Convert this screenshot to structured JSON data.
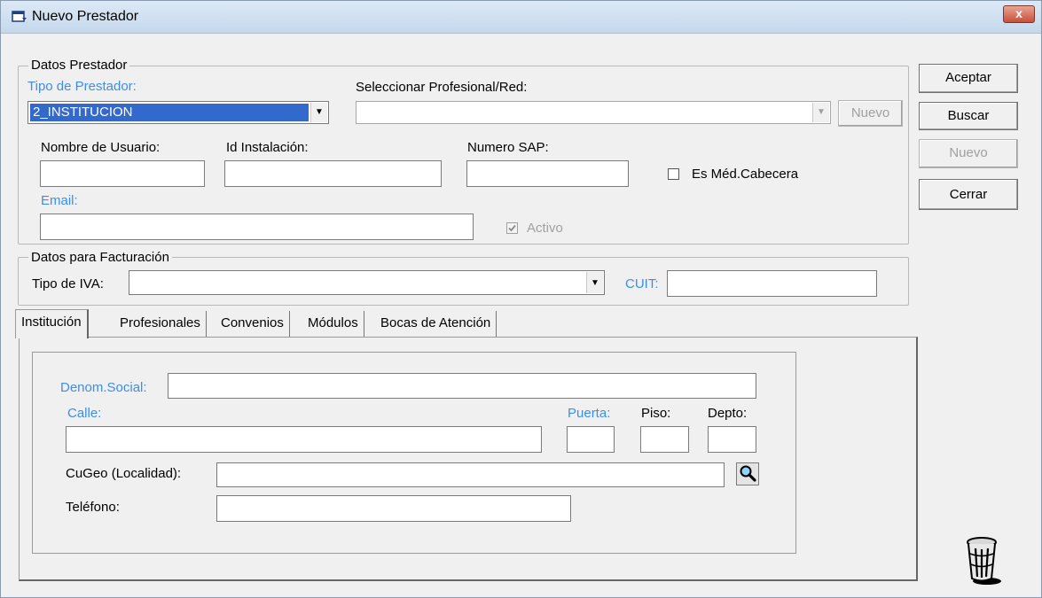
{
  "window": {
    "title": "Nuevo Prestador",
    "close_label": "x"
  },
  "datos_prestador": {
    "legend": "Datos Prestador",
    "tipo_label": "Tipo de Prestador:",
    "tipo_value": "2_INSTITUCION",
    "profesional_label": "Seleccionar Profesional/Red:",
    "profesional_value": "",
    "nuevo_label": "Nuevo",
    "usuario_label": "Nombre de Usuario:",
    "instalacion_label": "Id Instalación:",
    "sap_label": "Numero SAP:",
    "email_label": "Email:",
    "med_cabecera_label": "Es Méd.Cabecera",
    "activo_label": "Activo"
  },
  "facturacion": {
    "legend": "Datos para Facturación",
    "iva_label": "Tipo de IVA:",
    "iva_value": "",
    "cuit_label": "CUIT:"
  },
  "side_buttons": {
    "aceptar": "Aceptar",
    "buscar": "Buscar",
    "nuevo": "Nuevo",
    "cerrar": "Cerrar"
  },
  "tabs": [
    "Institución",
    "Profesionales",
    "Convenios",
    "Módulos",
    "Bocas de Atención"
  ],
  "institucion": {
    "denom_label": "Denom.Social:",
    "calle_label": "Calle:",
    "puerta_label": "Puerta:",
    "piso_label": "Piso:",
    "depto_label": "Depto:",
    "cugeo_label": "CuGeo (Localidad):",
    "telefono_label": "Teléfono:"
  }
}
